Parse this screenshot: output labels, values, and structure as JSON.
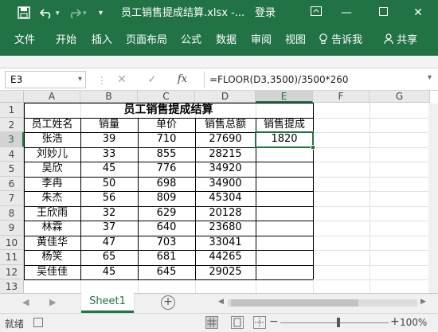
{
  "titlebar": {
    "save_icon": "save-icon",
    "undo_icon": "undo-icon",
    "redo_icon": "redo-icon",
    "customize_icon": "customize-quick-access-icon",
    "title": "员工销售提成结算.xlsx  -...",
    "login": "登录",
    "ribbon_display_icon": "ribbon-display-options-icon",
    "minimize_icon": "minimize-icon",
    "maximize_icon": "maximize-icon",
    "close_icon": "close-icon"
  },
  "ribbon": {
    "tabs": [
      "文件",
      "开始",
      "插入",
      "页面布局",
      "公式",
      "数据",
      "审阅",
      "视图",
      "告诉我",
      "共享"
    ],
    "tell_me_icon": "lightbulb-icon",
    "share_icon": "person-icon"
  },
  "formula_bar": {
    "name_box": "E3",
    "cancel_icon": "cancel-icon",
    "enter_icon": "check-icon",
    "function_icon": "fx",
    "formula": "=FLOOR(D3,3500)/3500*260"
  },
  "columns": [
    "A",
    "B",
    "C",
    "D",
    "E",
    "F",
    "G"
  ],
  "rows": [
    "1",
    "2",
    "3",
    "4",
    "5",
    "6",
    "7",
    "8",
    "9",
    "10",
    "11",
    "12",
    "13"
  ],
  "selected": {
    "column": "E",
    "row": "3"
  },
  "sheet": {
    "title": "员工销售提成结算",
    "headers": [
      "员工姓名",
      "销量",
      "单价",
      "销售总额",
      "销售提成"
    ],
    "records": [
      [
        "张浩",
        "39",
        "710",
        "27690",
        "1820"
      ],
      [
        "刘妙儿",
        "33",
        "855",
        "28215",
        ""
      ],
      [
        "吴欣",
        "45",
        "776",
        "34920",
        ""
      ],
      [
        "李冉",
        "50",
        "698",
        "34900",
        ""
      ],
      [
        "朱杰",
        "56",
        "809",
        "45304",
        ""
      ],
      [
        "王欣雨",
        "32",
        "629",
        "20128",
        ""
      ],
      [
        "林霖",
        "37",
        "640",
        "23680",
        ""
      ],
      [
        "黄佳华",
        "47",
        "703",
        "33041",
        ""
      ],
      [
        "杨笑",
        "65",
        "681",
        "44265",
        ""
      ],
      [
        "吴佳佳",
        "45",
        "645",
        "29025",
        ""
      ]
    ]
  },
  "tabs_bar": {
    "sheet_name": "Sheet1",
    "add_icon": "plus-circle-icon"
  },
  "status": {
    "ready": "就绪",
    "zoom": "100%",
    "zoom_level": 0.5,
    "minus": "−",
    "plus": "+"
  }
}
